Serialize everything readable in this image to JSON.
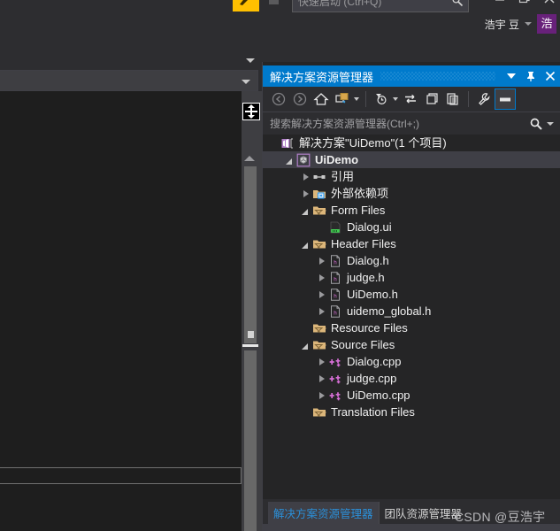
{
  "shell": {
    "quick_launch_placeholder": "快速启动 (Ctrl+Q)",
    "user_name": "浩宇 豆",
    "user_avatar_initial": "浩",
    "minimize_icon": "minimize-icon",
    "restore_icon": "restore-icon",
    "close_icon": "close-icon",
    "feedback_icon": "feedback-icon",
    "accent_color": "#007acc",
    "avatar_color": "#68217a",
    "highlight_color": "#ffc000"
  },
  "solution_explorer": {
    "title": "解决方案资源管理器",
    "titlebar_buttons": {
      "dropdown": "window-menu-dropdown",
      "pin": "pin-icon",
      "close": "close-icon"
    },
    "toolbar": [
      {
        "name": "back-button",
        "icon": "arrow-left-circle-icon",
        "caret": false,
        "selected": false
      },
      {
        "name": "forward-button",
        "icon": "arrow-right-circle-icon",
        "caret": false,
        "selected": false
      },
      {
        "name": "home-button",
        "icon": "home-icon",
        "caret": false,
        "selected": false
      },
      {
        "name": "sync-with-active-document-button",
        "icon": "sync-document-icon",
        "caret": true,
        "selected": false
      },
      {
        "name": "pending-changes-filter-button",
        "icon": "clock-filter-icon",
        "caret": true,
        "selected": false
      },
      {
        "name": "refresh-button",
        "icon": "refresh-arrows-icon",
        "caret": false,
        "selected": false
      },
      {
        "name": "collapse-all-button",
        "icon": "collapse-all-icon",
        "caret": false,
        "selected": false
      },
      {
        "name": "show-all-files-button",
        "icon": "show-all-files-icon",
        "caret": false,
        "selected": false
      },
      {
        "name": "properties-button",
        "icon": "wrench-icon",
        "caret": false,
        "selected": false
      },
      {
        "name": "preview-selected-items-button",
        "icon": "preview-pane-icon",
        "caret": false,
        "selected": true
      }
    ],
    "search_placeholder": "搜索解决方案资源管理器(Ctrl+;)",
    "search_icon": "search-icon",
    "tree": [
      {
        "label": "解决方案\"UiDemo\"(1 个项目)",
        "indent": 0,
        "expander": "none",
        "icon": "solution-icon",
        "bold": false,
        "selected": false
      },
      {
        "label": "UiDemo",
        "indent": 1,
        "expander": "open",
        "icon": "project-icon",
        "bold": true,
        "selected": true
      },
      {
        "label": "引用",
        "indent": 2,
        "expander": "closed",
        "icon": "references-icon",
        "bold": false,
        "selected": false
      },
      {
        "label": "外部依赖项",
        "indent": 2,
        "expander": "closed",
        "icon": "external-dependencies-icon",
        "bold": false,
        "selected": false
      },
      {
        "label": "Form Files",
        "indent": 2,
        "expander": "open",
        "icon": "filter-folder-icon",
        "bold": false,
        "selected": false
      },
      {
        "label": "Dialog.ui",
        "indent": 3,
        "expander": "none",
        "icon": "ui-file-icon",
        "bold": false,
        "selected": false
      },
      {
        "label": "Header Files",
        "indent": 2,
        "expander": "open",
        "icon": "filter-folder-icon",
        "bold": false,
        "selected": false
      },
      {
        "label": "Dialog.h",
        "indent": 3,
        "expander": "closed",
        "icon": "header-file-icon",
        "bold": false,
        "selected": false
      },
      {
        "label": "judge.h",
        "indent": 3,
        "expander": "closed",
        "icon": "header-file-icon",
        "bold": false,
        "selected": false
      },
      {
        "label": "UiDemo.h",
        "indent": 3,
        "expander": "closed",
        "icon": "header-file-icon",
        "bold": false,
        "selected": false
      },
      {
        "label": "uidemo_global.h",
        "indent": 3,
        "expander": "closed",
        "icon": "header-file-icon",
        "bold": false,
        "selected": false
      },
      {
        "label": "Resource Files",
        "indent": 2,
        "expander": "none",
        "icon": "filter-folder-icon",
        "bold": false,
        "selected": false
      },
      {
        "label": "Source Files",
        "indent": 2,
        "expander": "open",
        "icon": "filter-folder-icon",
        "bold": false,
        "selected": false
      },
      {
        "label": "Dialog.cpp",
        "indent": 3,
        "expander": "closed",
        "icon": "cpp-file-icon",
        "bold": false,
        "selected": false
      },
      {
        "label": "judge.cpp",
        "indent": 3,
        "expander": "closed",
        "icon": "cpp-file-icon",
        "bold": false,
        "selected": false
      },
      {
        "label": "UiDemo.cpp",
        "indent": 3,
        "expander": "closed",
        "icon": "cpp-file-icon",
        "bold": false,
        "selected": false
      },
      {
        "label": "Translation Files",
        "indent": 2,
        "expander": "none",
        "icon": "filter-folder-icon",
        "bold": false,
        "selected": false
      }
    ],
    "bottom_tabs": [
      {
        "label": "解决方案资源管理器",
        "active": true
      },
      {
        "label": "团队资源管理器",
        "active": false
      }
    ]
  },
  "watermark": "CSDN @豆浩宇"
}
